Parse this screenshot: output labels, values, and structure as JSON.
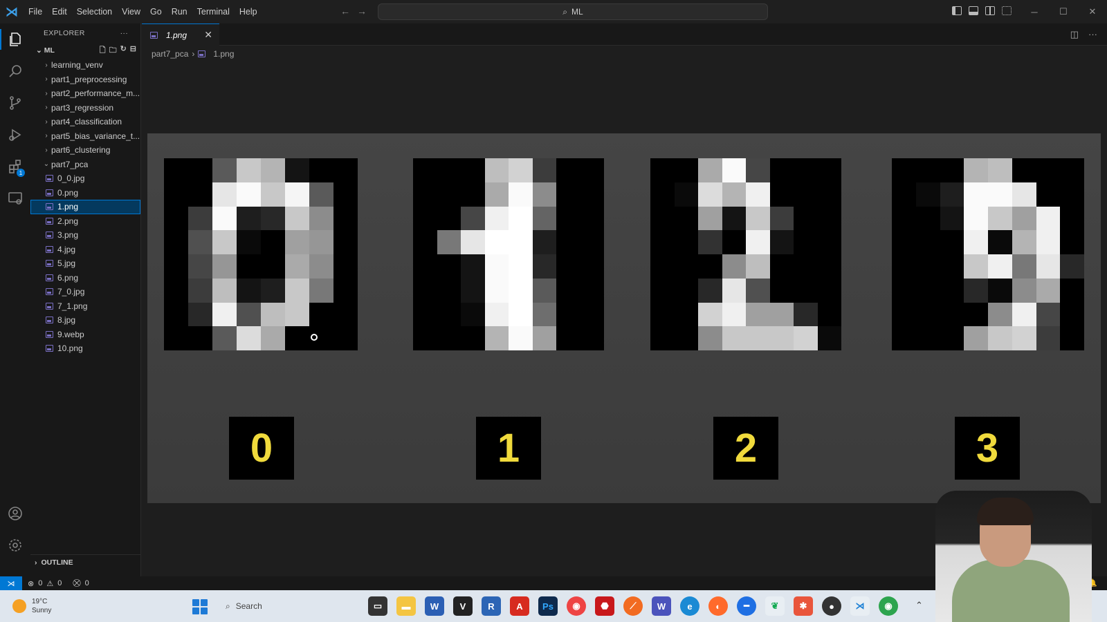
{
  "titlebar": {
    "menu": [
      "File",
      "Edit",
      "Selection",
      "View",
      "Go",
      "Run",
      "Terminal",
      "Help"
    ],
    "search": "ML"
  },
  "sidebar": {
    "header": "EXPLORER",
    "root": "ML",
    "folders": [
      "learning_venv",
      "part1_preprocessing",
      "part2_performance_m...",
      "part3_regression",
      "part4_classification",
      "part5_bias_variance_t...",
      "part6_clustering",
      "part7_pca"
    ],
    "files": [
      "0_0.jpg",
      "0.png",
      "1.png",
      "2.png",
      "3.png",
      "4.jpg",
      "5.jpg",
      "6.png",
      "7_0.jpg",
      "7_1.png",
      "8.jpg",
      "9.webp",
      "10.png"
    ],
    "selected_file": "1.png",
    "outline": "OUTLINE"
  },
  "tab": {
    "label": "1.png"
  },
  "breadcrumb": {
    "folder": "part7_pca",
    "file": "1.png"
  },
  "image_content": {
    "digits": [
      {
        "label": "0",
        "pixels": [
          [
            0,
            0,
            90,
            200,
            180,
            20,
            0,
            0
          ],
          [
            0,
            0,
            230,
            250,
            200,
            245,
            90,
            0
          ],
          [
            0,
            60,
            250,
            30,
            40,
            200,
            140,
            0
          ],
          [
            0,
            80,
            200,
            10,
            0,
            160,
            150,
            0
          ],
          [
            0,
            70,
            150,
            0,
            0,
            170,
            140,
            0
          ],
          [
            0,
            60,
            190,
            20,
            30,
            200,
            120,
            0
          ],
          [
            0,
            40,
            240,
            80,
            190,
            200,
            0,
            0
          ],
          [
            0,
            0,
            90,
            220,
            170,
            0,
            0,
            0
          ]
        ]
      },
      {
        "label": "1",
        "pixels": [
          [
            0,
            0,
            0,
            190,
            210,
            60,
            0,
            0
          ],
          [
            0,
            0,
            0,
            170,
            250,
            140,
            0,
            0
          ],
          [
            0,
            0,
            70,
            240,
            255,
            100,
            0,
            0
          ],
          [
            0,
            120,
            230,
            255,
            255,
            30,
            0,
            0
          ],
          [
            0,
            0,
            20,
            250,
            255,
            40,
            0,
            0
          ],
          [
            0,
            0,
            20,
            250,
            255,
            90,
            0,
            0
          ],
          [
            0,
            0,
            10,
            240,
            255,
            110,
            0,
            0
          ],
          [
            0,
            0,
            0,
            180,
            250,
            160,
            0,
            0
          ]
        ]
      },
      {
        "label": "2",
        "pixels": [
          [
            0,
            0,
            170,
            250,
            70,
            0,
            0,
            0
          ],
          [
            0,
            10,
            220,
            180,
            240,
            0,
            0,
            0
          ],
          [
            0,
            0,
            160,
            20,
            200,
            60,
            0,
            0
          ],
          [
            0,
            0,
            50,
            0,
            240,
            20,
            0,
            0
          ],
          [
            0,
            0,
            0,
            140,
            190,
            0,
            0,
            0
          ],
          [
            0,
            0,
            40,
            230,
            80,
            0,
            0,
            0
          ],
          [
            0,
            0,
            210,
            240,
            160,
            160,
            40,
            0
          ],
          [
            0,
            0,
            140,
            200,
            200,
            200,
            210,
            10
          ]
        ]
      },
      {
        "label": "3",
        "pixels": [
          [
            0,
            0,
            0,
            180,
            190,
            0,
            0,
            0
          ],
          [
            0,
            10,
            30,
            250,
            250,
            230,
            0,
            0
          ],
          [
            0,
            0,
            20,
            250,
            200,
            160,
            240,
            0
          ],
          [
            0,
            0,
            0,
            240,
            10,
            180,
            240,
            0
          ],
          [
            0,
            0,
            0,
            200,
            240,
            120,
            230,
            40
          ],
          [
            0,
            0,
            0,
            40,
            10,
            140,
            170,
            0
          ],
          [
            0,
            0,
            0,
            0,
            140,
            240,
            70,
            0
          ],
          [
            0,
            0,
            0,
            160,
            200,
            210,
            60,
            0
          ]
        ]
      }
    ]
  },
  "status": {
    "errors": "0",
    "warnings": "0",
    "ports": "0"
  },
  "taskbar": {
    "temp": "19°C",
    "weather": "Sunny",
    "search": "Search"
  }
}
